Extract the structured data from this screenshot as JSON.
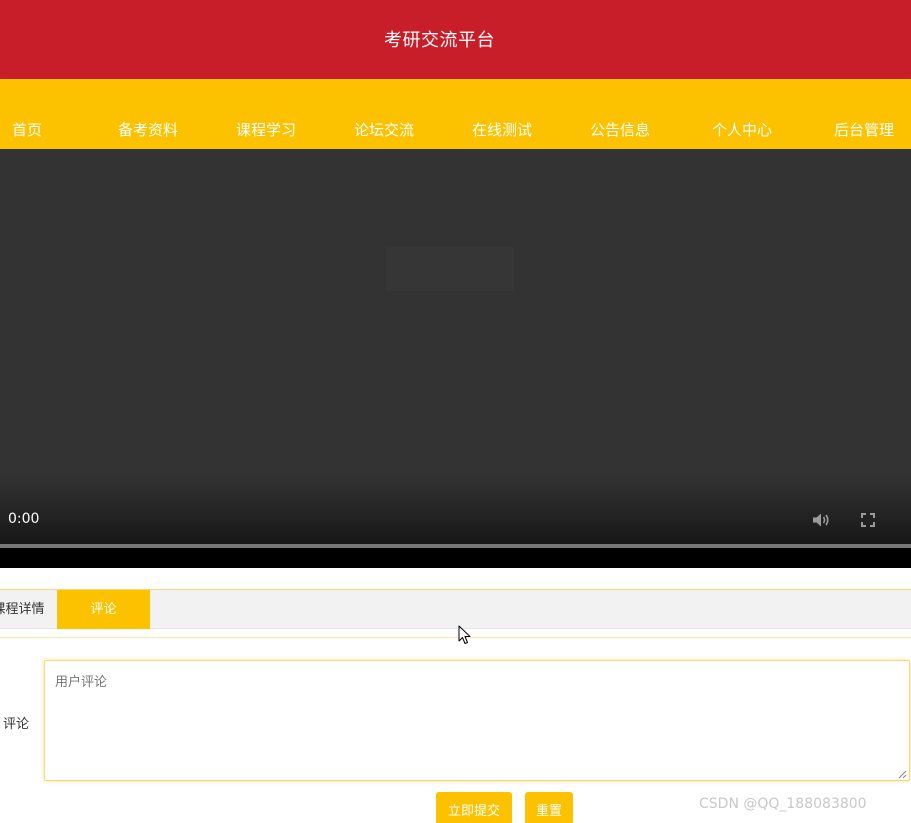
{
  "header": {
    "title": "考研交流平台"
  },
  "nav": {
    "items": [
      {
        "label": "首页"
      },
      {
        "label": "备考资料"
      },
      {
        "label": "课程学习"
      },
      {
        "label": "论坛交流"
      },
      {
        "label": "在线测试"
      },
      {
        "label": "公告信息"
      },
      {
        "label": "个人中心"
      },
      {
        "label": "后台管理"
      }
    ]
  },
  "video": {
    "current_time": "0:00",
    "progress": 0
  },
  "tabs": [
    {
      "label": "课程详情",
      "active": false
    },
    {
      "label": "评论",
      "active": true
    }
  ],
  "comment": {
    "label": "评论",
    "placeholder": "用户评论",
    "value": "",
    "submit_label": "立即提交",
    "reset_label": "重置"
  },
  "watermark": "CSDN @QQ_188083800",
  "colors": {
    "header_bg": "#c81e2a",
    "nav_bg": "#fcc200",
    "accent": "#fcc200",
    "video_bg": "#333333"
  },
  "icons": [
    "volume-icon",
    "fullscreen-icon",
    "mouse-cursor-icon",
    "resize-grip-icon"
  ]
}
